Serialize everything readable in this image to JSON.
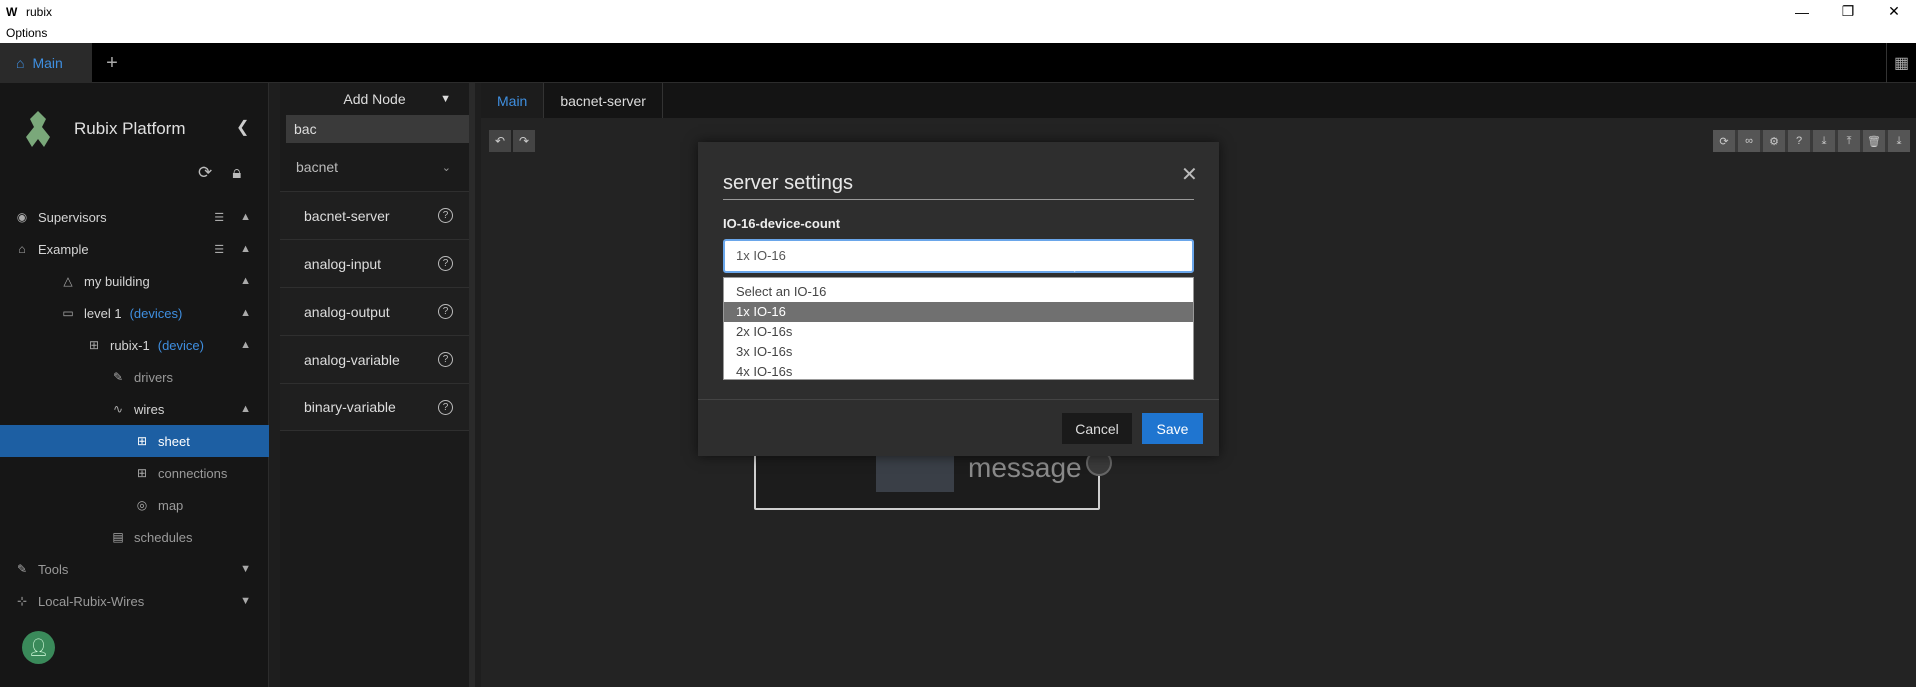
{
  "window": {
    "logo": "W",
    "title": "rubix",
    "menu": "Options",
    "controls": {
      "minimize": "—",
      "restore": "❐",
      "close": "✕"
    }
  },
  "top_tabs": {
    "main": {
      "label": "Main",
      "icon": "home-icon"
    },
    "add": "+"
  },
  "sidebar": {
    "brand": "Rubix Platform",
    "items": [
      {
        "label": "Supervisors",
        "icon": "eye-icon"
      },
      {
        "label": "Example",
        "icon": "home-icon"
      },
      {
        "label": "my building",
        "icon": "warning-triangle-icon"
      },
      {
        "label": "level 1",
        "tag": "(devices)",
        "icon": "monitor-icon"
      },
      {
        "label": "rubix-1",
        "tag": "(device)",
        "icon": "device-icon"
      },
      {
        "label": "drivers",
        "icon": "wrench-icon"
      },
      {
        "label": "wires",
        "icon": "wires-icon"
      },
      {
        "label": "sheet",
        "icon": "sheet-icon"
      },
      {
        "label": "connections",
        "icon": "connections-icon"
      },
      {
        "label": "map",
        "icon": "map-icon"
      },
      {
        "label": "schedules",
        "icon": "calendar-icon"
      },
      {
        "label": "Tools",
        "icon": "tools-icon"
      },
      {
        "label": "Local-Rubix-Wires",
        "icon": "network-icon"
      }
    ]
  },
  "node_panel": {
    "header": "Add Node",
    "search_value": "bac",
    "category": "bacnet",
    "nodes": [
      "bacnet-server",
      "analog-input",
      "analog-output",
      "analog-variable",
      "binary-variable"
    ],
    "help_glyph": "?"
  },
  "canvas": {
    "tabs": [
      "Main",
      "bacnet-server"
    ],
    "node_label": "message"
  },
  "modal": {
    "title": "server settings",
    "field_label": "IO-16-device-count",
    "selected": "1x IO-16",
    "options": [
      "Select an IO-16",
      "1x IO-16",
      "2x IO-16s",
      "3x IO-16s",
      "4x IO-16s"
    ],
    "cancel": "Cancel",
    "save": "Save"
  },
  "colors": {
    "accent": "#1f75d0",
    "selected_row": "#1d5fa3",
    "link": "#3f8fe0"
  }
}
